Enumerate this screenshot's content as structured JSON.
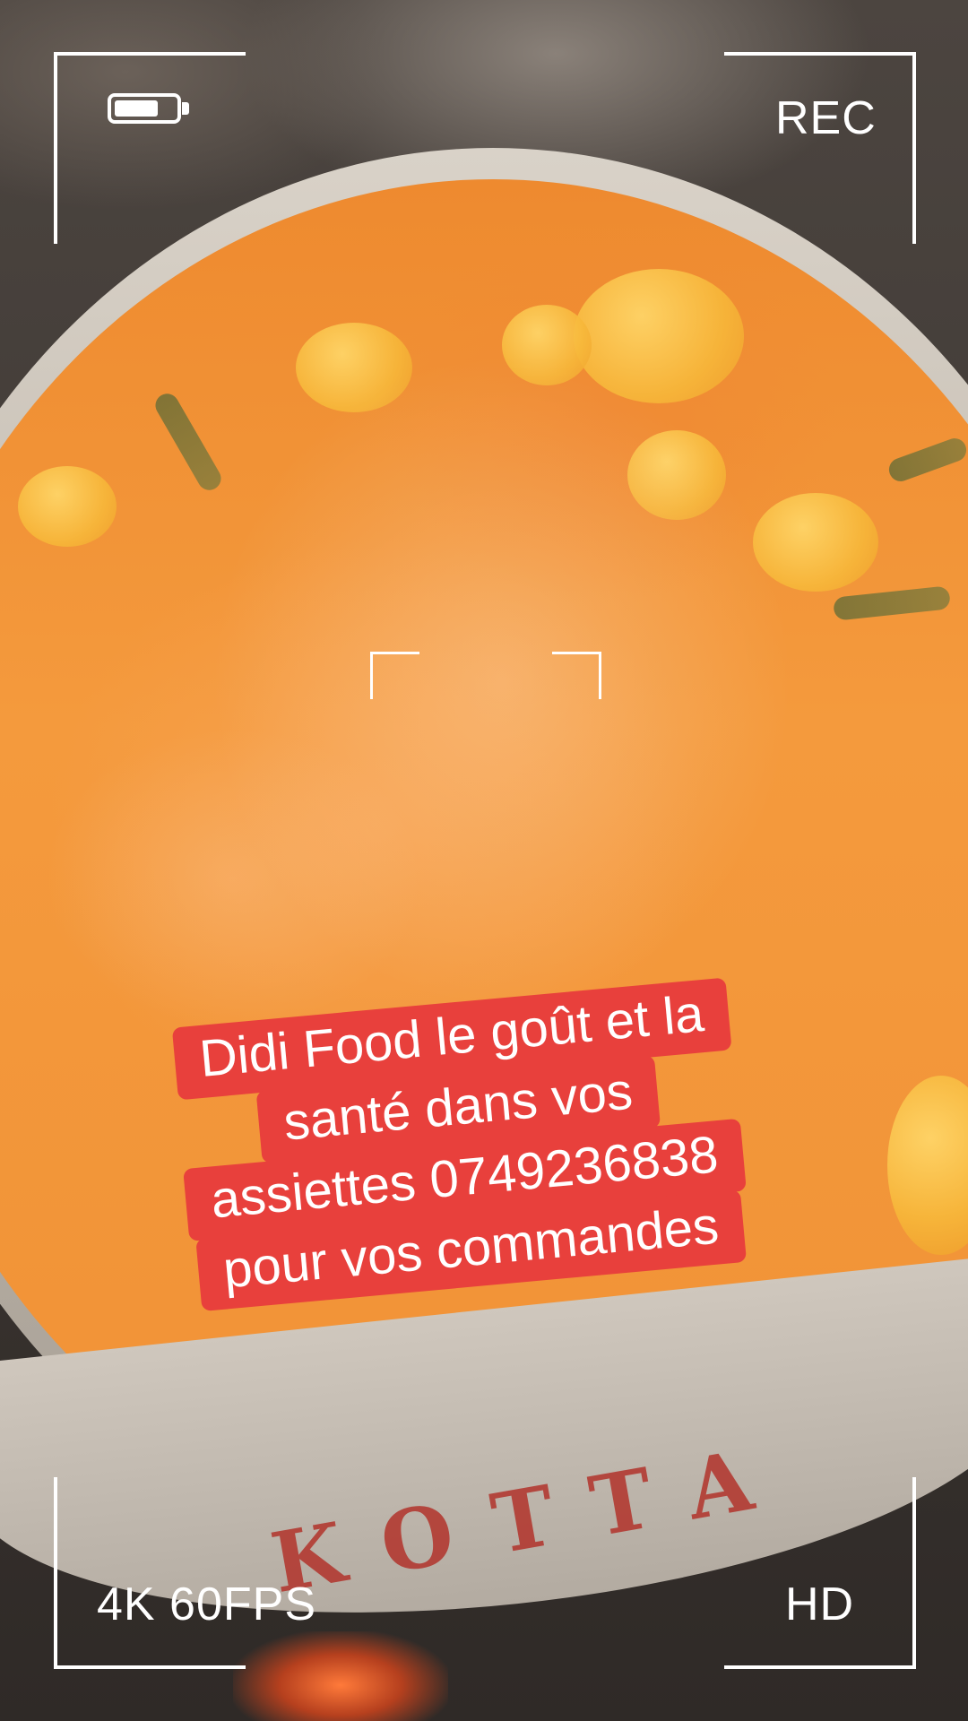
{
  "overlay": {
    "status_left": "REC",
    "bottom_left": "4K 60FPS",
    "bottom_right": "HD",
    "battery_level": 0.72
  },
  "caption": {
    "lines": [
      "Didi Food le goût et la",
      "santé dans vos",
      "assiettes 0749236838",
      "pour vos commandes"
    ]
  },
  "background": {
    "pot_lettering": "KOTTA",
    "colors": {
      "soup": "#f19236",
      "caption_bg": "#e8403c",
      "overlay": "#ffffff"
    }
  }
}
